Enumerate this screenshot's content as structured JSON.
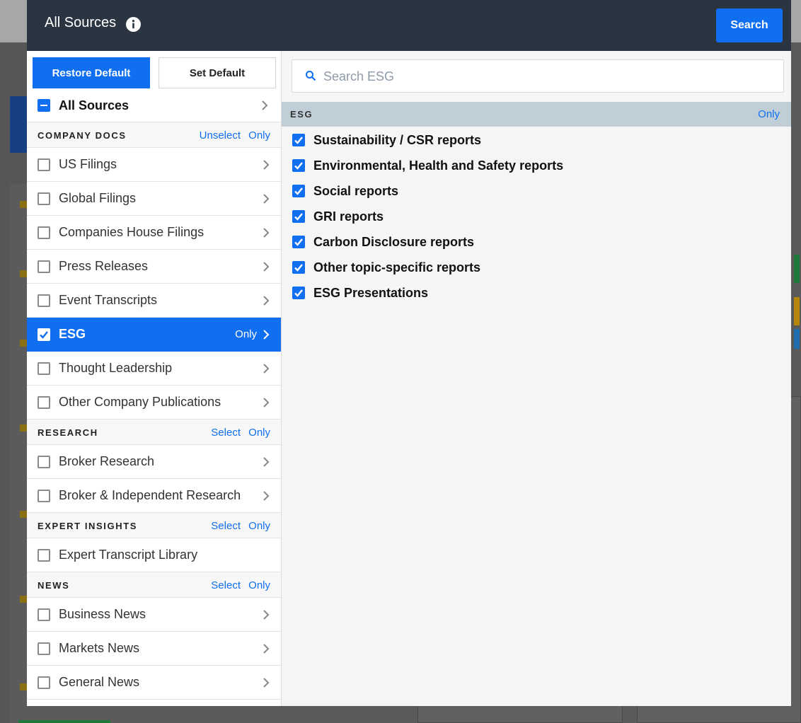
{
  "modal": {
    "title": "All Sources",
    "search_button": "Search"
  },
  "left": {
    "restore_default": "Restore Default",
    "set_default": "Set Default",
    "all_sources": "All Sources",
    "sections": [
      {
        "title": "COMPANY DOCS",
        "action1": "Unselect",
        "action2": "Only",
        "items": [
          {
            "label": "US Filings",
            "checked": false
          },
          {
            "label": "Global Filings",
            "checked": false
          },
          {
            "label": "Companies House Filings",
            "checked": false
          },
          {
            "label": "Press Releases",
            "checked": false
          },
          {
            "label": "Event Transcripts",
            "checked": false
          },
          {
            "label": "ESG",
            "checked": true,
            "active": true,
            "inline_only": "Only"
          },
          {
            "label": "Thought Leadership",
            "checked": false
          },
          {
            "label": "Other Company Publications",
            "checked": false
          }
        ]
      },
      {
        "title": "RESEARCH",
        "action1": "Select",
        "action2": "Only",
        "items": [
          {
            "label": "Broker Research",
            "checked": false
          },
          {
            "label": "Broker & Independent Research",
            "checked": false
          }
        ]
      },
      {
        "title": "EXPERT INSIGHTS",
        "action1": "Select",
        "action2": "Only",
        "items": [
          {
            "label": "Expert Transcript Library",
            "checked": false
          }
        ]
      },
      {
        "title": "NEWS",
        "action1": "Select",
        "action2": "Only",
        "items": [
          {
            "label": "Business News",
            "checked": false
          },
          {
            "label": "Markets News",
            "checked": false
          },
          {
            "label": "General News",
            "checked": false
          }
        ]
      }
    ]
  },
  "right": {
    "search_placeholder": "Search ESG",
    "group_title": "ESG",
    "group_only": "Only",
    "items": [
      "Sustainability / CSR reports",
      "Environmental, Health and Safety reports",
      "Social reports",
      "GRI reports",
      "Carbon Disclosure reports",
      "Other topic-specific reports",
      "ESG Presentations"
    ]
  },
  "colors": {
    "header_bg": "#2b3542",
    "accent": "#0f6ff0",
    "group_bar": "#c0cfd7"
  }
}
